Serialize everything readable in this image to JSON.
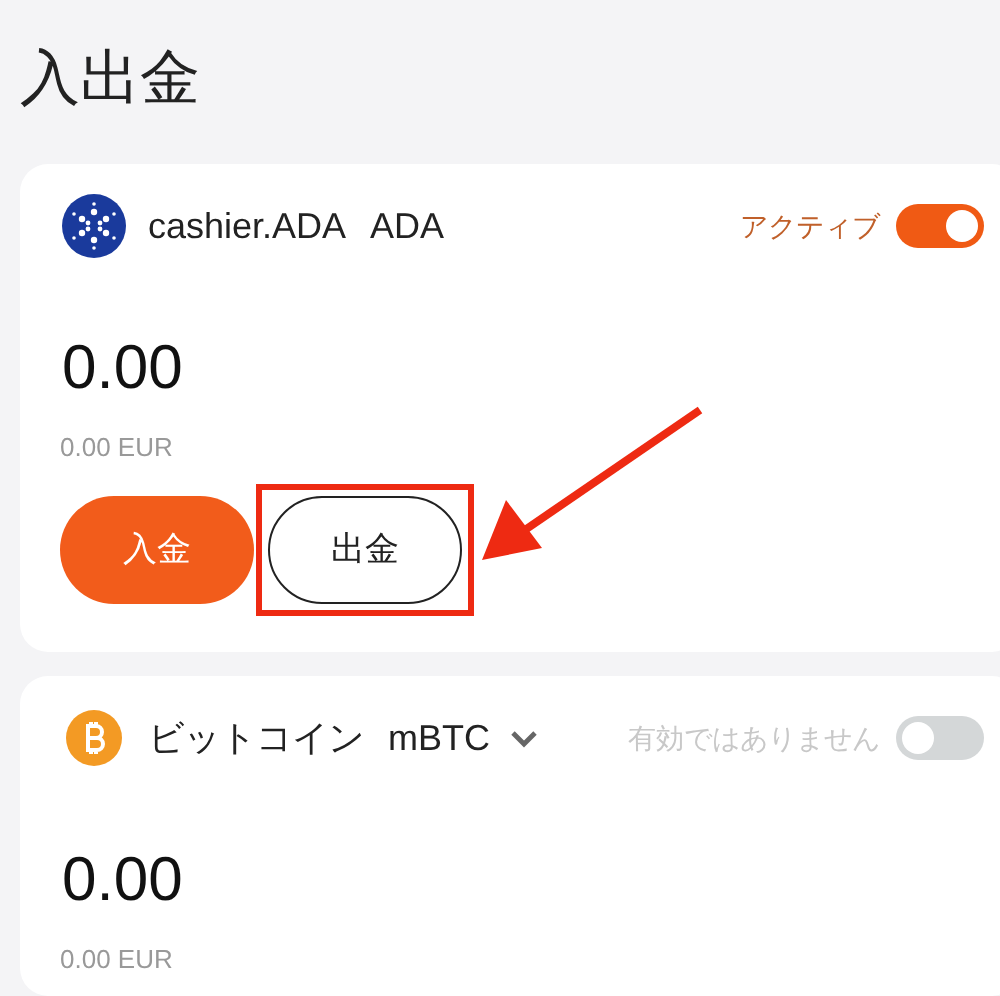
{
  "title": "入出金",
  "accounts": [
    {
      "kind": "cardano",
      "name": "cashier.ADA",
      "currency": "ADA",
      "dropdown": false,
      "status_label": "アクティブ",
      "on": true,
      "amount": "0.00",
      "fiat": "0.00 EUR",
      "buttons": [
        {
          "label": "入金",
          "kind": "primary",
          "highlighted": false
        },
        {
          "label": "出金",
          "kind": "outline",
          "highlighted": true
        }
      ]
    },
    {
      "kind": "bitcoin",
      "name": "ビットコイン",
      "currency": "mBTC",
      "dropdown": true,
      "status_label": "有効ではありません",
      "on": false,
      "amount": "0.00",
      "fiat": "0.00 EUR"
    }
  ]
}
